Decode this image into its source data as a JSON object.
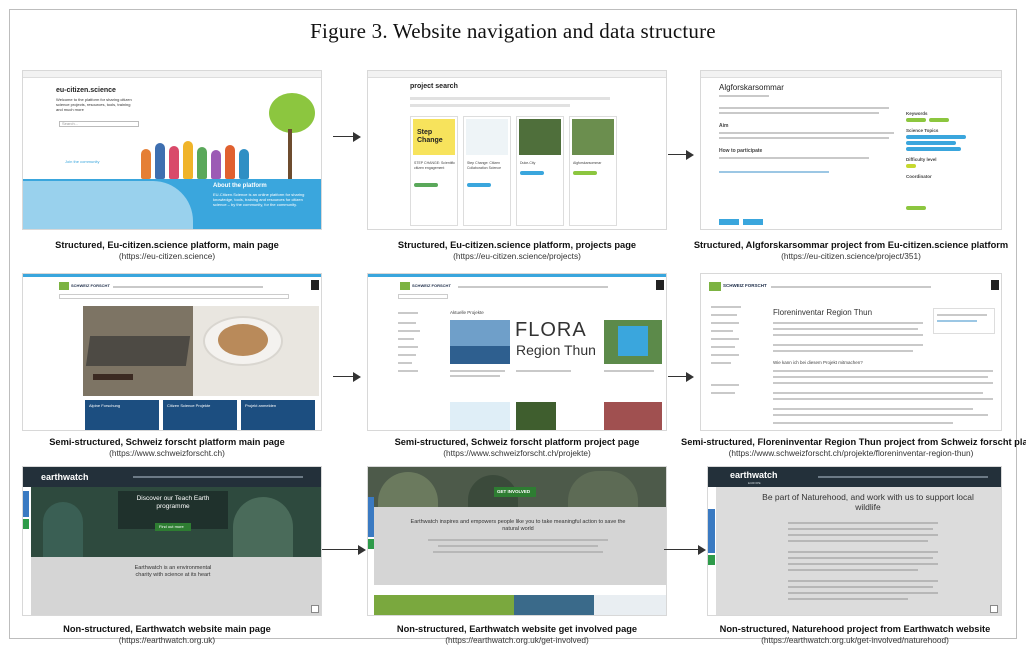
{
  "figure": {
    "title": "Figure 3. Website navigation and data structure"
  },
  "rows": [
    {
      "panels": [
        {
          "caption": "Structured, Eu-citizen.science platform, main page",
          "url": "(https://eu-citizen.science)",
          "screen": {
            "logo": "eu-citizen.science",
            "heading": "Welcome to the platform for sharing citizen science projects, resources, tools, training and much more",
            "section": "About the platform",
            "card_text": "EU-Citizen.Science is an online platform for sharing knowledge, tools, training and resources for citizen science – by the community, for the community.",
            "search_hint": "Search...",
            "cta": "Join the community"
          }
        },
        {
          "caption": "Structured, Eu-citizen.science platform, projects page",
          "url": "(https://eu-citizen.science/projects)",
          "screen": {
            "heading": "project search",
            "card1_title": "Step Change",
            "card1_text": "STEP CHANGE: Scientific citizen engagement",
            "card2_text": "Step Change: Citizen Collaboration Science",
            "card3_text": "Duke-City",
            "card4_text": "Algforskarsommar"
          }
        },
        {
          "caption": "Structured, Algforskarsommar project from Eu-citizen.science platform",
          "url": "(https://eu-citizen.science/project/351)",
          "screen": {
            "project_title": "Algforskarsommar",
            "aim_heading": "Aim",
            "participate_heading": "How to participate",
            "side_heading1": "Keywords",
            "side_heading2": "Science Topics",
            "side_heading3": "Difficulty level",
            "side_heading4": "Coordinator"
          }
        }
      ]
    },
    {
      "panels": [
        {
          "caption": "Semi-structured, Schweiz forscht platform main page",
          "url": "(https://www.schweizforscht.ch)",
          "screen": {
            "logo": "SCHWEIZ FORSCHT",
            "tile1": "Alpine Forschung",
            "tile2": "Citizen Science Projekte",
            "tile3": "Projekt anmelden"
          }
        },
        {
          "caption": "Semi-structured, Schweiz forscht platform project page",
          "url": "(https://www.schweizforscht.ch/projekte)",
          "screen": {
            "logo": "SCHWEIZ FORSCHT",
            "heading": "Aktuelle Projekte",
            "banner_big": "FLORA",
            "banner_sub": "Region Thun"
          }
        },
        {
          "caption": "Semi-structured, Floreninventar Region Thun project from Schweiz forscht platform",
          "url": "(https://www.schweizforscht.ch/projekte/floreninventar-region-thun)",
          "screen": {
            "logo": "SCHWEIZ FORSCHT",
            "heading": "Floreninventar Region Thun",
            "subheading": "Wie kann ich bei diesem Projekt mitmachen?"
          }
        }
      ]
    },
    {
      "panels": [
        {
          "caption": "Non-structured, Earthwatch website main page",
          "url": "(https://earthwatch.org.uk)",
          "screen": {
            "logo": "earthwatch",
            "hero": "Discover our Teach Earth programme",
            "hero_btn": "Find out more",
            "body": "Earthwatch is an environmental charity with science at its heart"
          }
        },
        {
          "caption": "Non-structured, Earthwatch website get involved page",
          "url": "(https://earthwatch.org.uk/get-involved)",
          "screen": {
            "badge": "GET INVOLVED",
            "body": "Earthwatch inspires and empowers people like you to take meaningful action to save the natural world"
          }
        },
        {
          "caption": "Non-structured, Naturehood project from Earthwatch website",
          "url": "(https://earthwatch.org.uk/get-involved/naturehood)",
          "screen": {
            "logo": "earthwatch",
            "logo_sub": "EUROPE",
            "heading": "Be part of Naturehood, and work with us to support local wildlife"
          }
        }
      ]
    }
  ],
  "colors": {
    "eu_blue": "#3aa6dd",
    "eu_green": "#8cc63f",
    "sf_navy": "#1c2c48",
    "sf_green": "#7cb342",
    "ew_dark": "#23303a",
    "ew_gray": "#d5d5d5",
    "ew_green": "#2e7d32"
  }
}
